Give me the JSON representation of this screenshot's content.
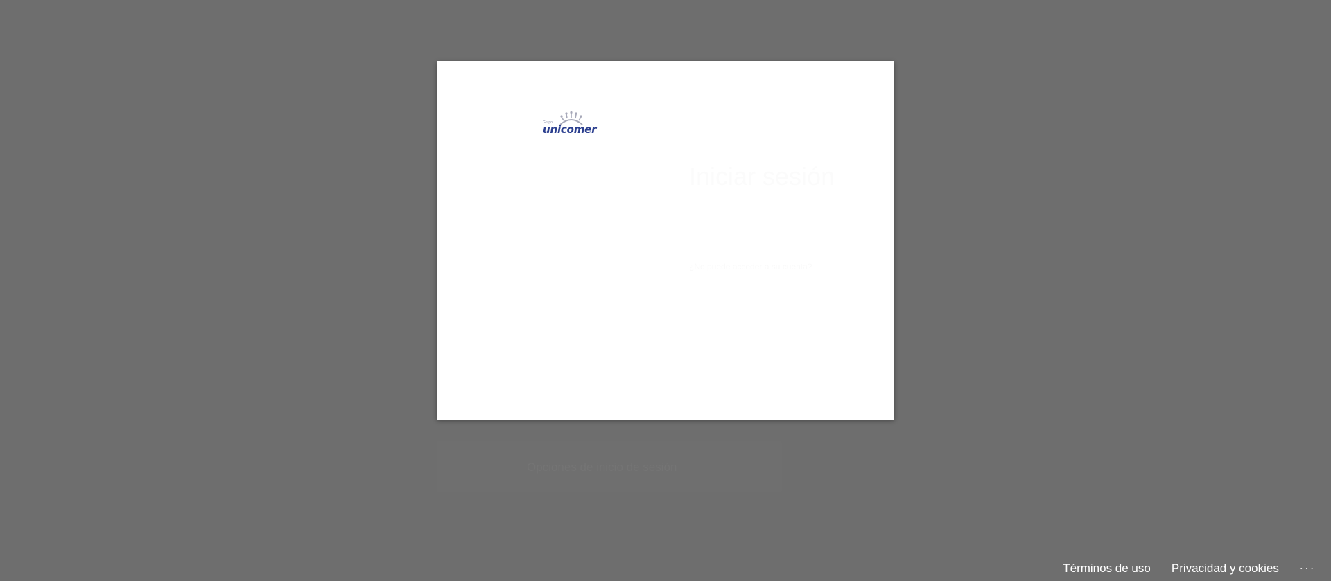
{
  "logo": {
    "brand": "unicomer",
    "prefix": "Grupo"
  },
  "card": {
    "title": "Iniciar sesión",
    "faint_text": "¿No puede acceder a su cuenta?"
  },
  "below_card": {
    "text": "Opciones de inicio de sesión"
  },
  "footer": {
    "terms_label": "Términos de uso",
    "privacy_label": "Privacidad y cookies",
    "more_label": "..."
  },
  "colors": {
    "background": "#6e6e6e",
    "card": "#ffffff",
    "logo_blue": "#2b3f8f",
    "logo_sun": "#a7a9b9",
    "footer_text": "#ffffff"
  },
  "icons": {
    "logo": "unicomer-logo"
  }
}
